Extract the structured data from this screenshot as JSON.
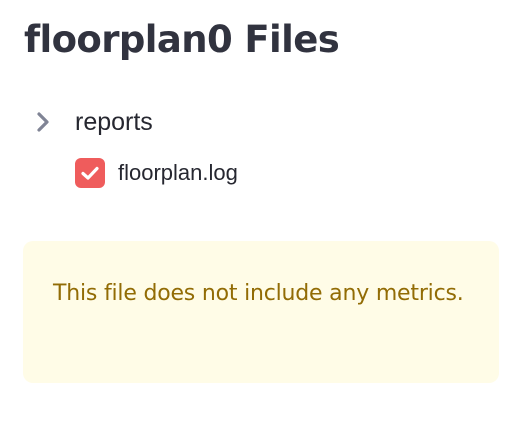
{
  "header": {
    "title": "floorplan0 Files"
  },
  "tree": {
    "folder": {
      "label": "reports",
      "icon": "chevron-right-icon",
      "expanded": true
    },
    "file": {
      "label": "floorplan.log",
      "icon": "checkbox-checked-icon",
      "checked": true
    }
  },
  "alert": {
    "message": "This file does not include any metrics."
  },
  "colors": {
    "title": "#31333f",
    "text": "#262730",
    "chevron": "#808495",
    "checkbox": "#ef5c5c",
    "alert_background": "#fffce7",
    "alert_text": "#926c05"
  }
}
